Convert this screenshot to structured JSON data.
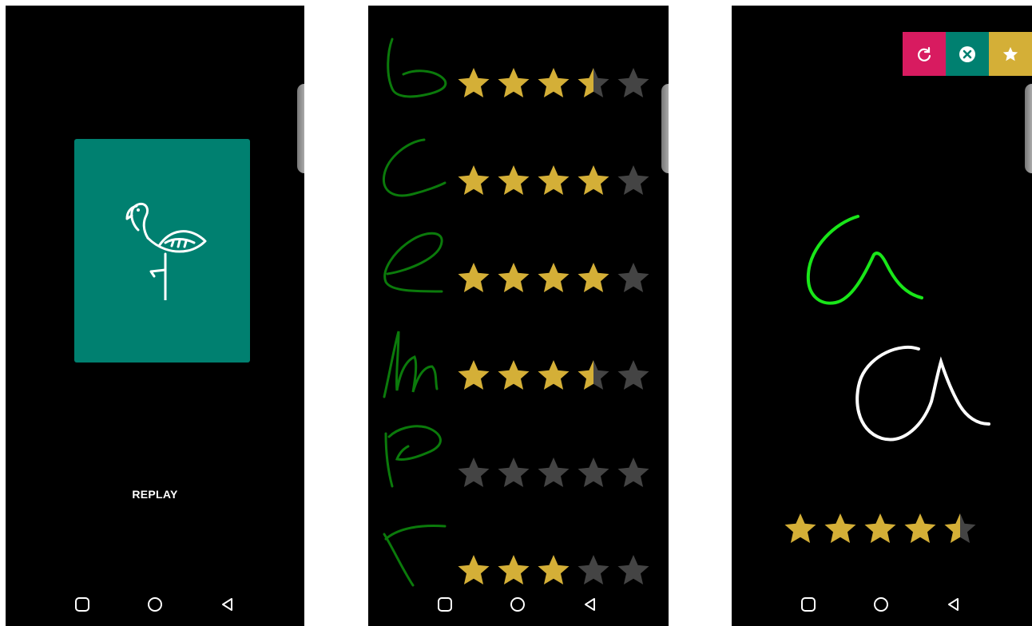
{
  "screens": [
    {
      "id": "flamingo-card-screen",
      "card_icon": "flamingo-icon",
      "card_color": "#008070",
      "replay_label": "REPLAY"
    },
    {
      "id": "letter-ratings-screen",
      "rows": [
        {
          "letter": "b",
          "rating": 3.5
        },
        {
          "letter": "c",
          "rating": 4
        },
        {
          "letter": "e",
          "rating": 4
        },
        {
          "letter": "m",
          "rating": 3.5
        },
        {
          "letter": "p",
          "rating": 0
        },
        {
          "letter": "r",
          "rating": 3
        }
      ],
      "max_rating": 5,
      "stroke_color": "#0b7a0b"
    },
    {
      "id": "letter-practice-screen",
      "actions": [
        {
          "icon": "refresh-icon",
          "color": "#d81b60"
        },
        {
          "icon": "close-icon",
          "color": "#008070"
        },
        {
          "icon": "star-icon",
          "color": "#d4af37"
        }
      ],
      "reference_stroke_color": "#19e619",
      "user_stroke_color": "#ffffff",
      "rating": 4.5,
      "max_rating": 5
    }
  ],
  "navigation": [
    "recents-icon",
    "home-icon",
    "back-icon"
  ],
  "colors": {
    "star_filled": "#d4af37",
    "star_empty": "#444444",
    "background": "#000000"
  }
}
